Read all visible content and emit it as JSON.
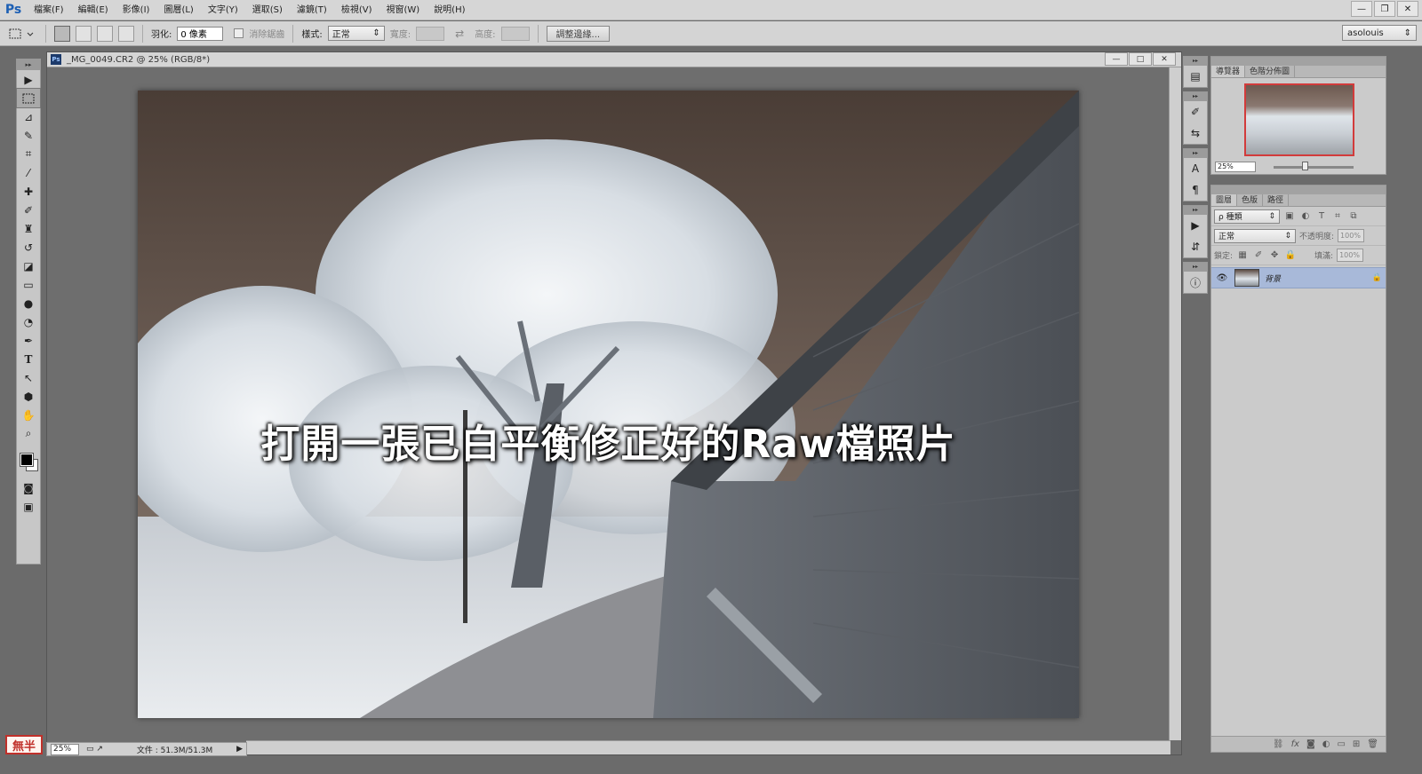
{
  "menu": {
    "logo": "Ps",
    "items": [
      "檔案(F)",
      "編輯(E)",
      "影像(I)",
      "圖層(L)",
      "文字(Y)",
      "選取(S)",
      "濾鏡(T)",
      "檢視(V)",
      "視窗(W)",
      "說明(H)"
    ],
    "minimize": "—",
    "restore": "❐",
    "close": "✕"
  },
  "options": {
    "feather_label": "羽化:",
    "feather_value": "0 像素",
    "antialias_label": "消除鋸齒",
    "style_label": "樣式:",
    "style_value": "正常",
    "width_label": "寬度:",
    "height_label": "高度:",
    "swap": "⇄",
    "refine_button": "調整邊緣...",
    "workspace": "asolouis"
  },
  "document": {
    "ps_badge": "Ps",
    "title": "_MG_0049.CR2 @ 25% (RGB/8*)",
    "caption": "打開一張已白平衡修正好的Raw檔照片"
  },
  "status": {
    "zoom": "25%",
    "doc_size": "文件 : 51.3M/51.3M"
  },
  "stamp": "無半",
  "navigator": {
    "tabs": [
      "導覽器",
      "色階分佈圖"
    ],
    "zoom": "25%"
  },
  "layers": {
    "tabs": [
      "圖層",
      "色版",
      "路徑"
    ],
    "kind_value": "ρ 種類",
    "blend_value": "正常",
    "opacity_label": "不透明度:",
    "opacity_value": "100%",
    "lock_label": "鎖定:",
    "fill_label": "填滿:",
    "fill_value": "100%",
    "layer_name": "背景"
  },
  "colors": {
    "accent": "#1c5fb4",
    "layer_selected": "#a8b9d9",
    "nav_frame": "#d23b3b"
  }
}
